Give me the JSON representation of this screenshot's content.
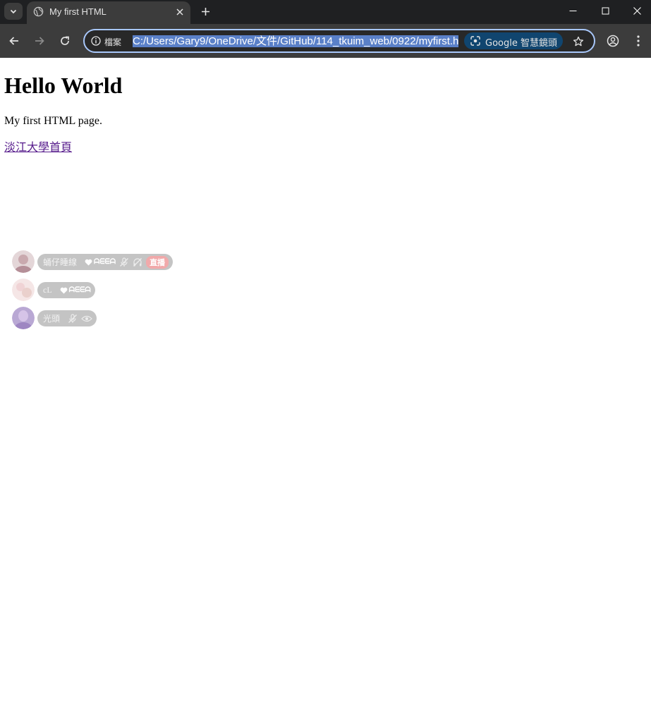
{
  "browser": {
    "tab_title": "My first HTML",
    "site_info_label": "檔案",
    "url": "C:/Users/Gary9/OneDrive/文件/GitHub/114_tkuim_web/0922/myfirst.h",
    "lens_label": "Google 智慧鏡頭"
  },
  "page": {
    "heading": "Hello World",
    "paragraph": "My first HTML page.",
    "link_text": "淡江大學首頁"
  },
  "voice_overlay": {
    "users": [
      {
        "name": "蛹仔睡線",
        "badge": "ᗩᗴᗴᗩ",
        "live_label": "直播"
      },
      {
        "name": "cL",
        "badge": "ᗩᗴᗴᗩ"
      },
      {
        "name": "光頭"
      }
    ]
  },
  "colors": {
    "tabbar_bg": "#1f2022",
    "toolbar_bg": "#3c3c3c",
    "omnibox_border": "#a8c7fa",
    "lens_bg": "#10456f",
    "visited_link": "#551a8b",
    "overlay_pill": "#c4c4c4",
    "live_badge": "#f1a9aa"
  }
}
